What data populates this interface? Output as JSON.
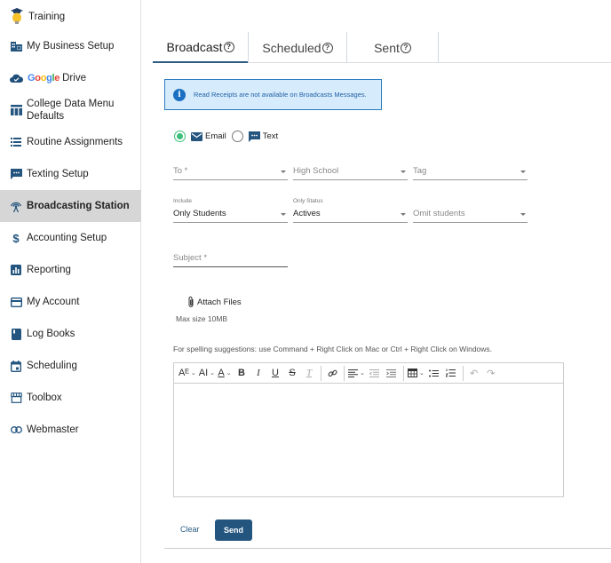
{
  "sidebar": {
    "items": [
      {
        "label": "Training",
        "icon": "lightbulb-graduation-cap-icon"
      },
      {
        "label": "My Business Setup",
        "icon": "building-icon"
      },
      {
        "label_google": "Google",
        "label": "Drive",
        "icon": "cloud-check-icon"
      },
      {
        "label": "College Data Menu Defaults",
        "icon": "table-columns-icon"
      },
      {
        "label": "Routine Assignments",
        "icon": "list-icon"
      },
      {
        "label": "Texting Setup",
        "icon": "chat-bubble-icon"
      },
      {
        "label": "Broadcasting Station",
        "icon": "broadcast-antenna-icon",
        "active": true
      },
      {
        "label": "Accounting Setup",
        "icon": "dollar-icon"
      },
      {
        "label": "Reporting",
        "icon": "bar-chart-icon"
      },
      {
        "label": "My Account",
        "icon": "credit-card-icon"
      },
      {
        "label": "Log Books",
        "icon": "book-icon"
      },
      {
        "label": "Scheduling",
        "icon": "calendar-icon"
      },
      {
        "label": "Toolbox",
        "icon": "storefront-icon"
      },
      {
        "label": "Webmaster",
        "icon": "link-icon"
      }
    ]
  },
  "tabs": [
    {
      "label": "Broadcast",
      "active": true
    },
    {
      "label": "Scheduled",
      "active": false
    },
    {
      "label": "Sent",
      "active": false
    }
  ],
  "info": {
    "message": "Read Receipts are not available on Broadcasts Messages."
  },
  "channel": {
    "selected": "Email",
    "options": [
      "Email",
      "Text"
    ]
  },
  "filters": {
    "to": {
      "placeholder": "To *"
    },
    "high_school": {
      "placeholder": "High School"
    },
    "tag": {
      "placeholder": "Tag"
    },
    "include": {
      "label": "Include",
      "value": "Only Students"
    },
    "only_status": {
      "label": "Only Status",
      "value": "Actives"
    },
    "omit": {
      "placeholder": "Omit students"
    }
  },
  "subject": {
    "placeholder": "Subject *"
  },
  "attach": {
    "label": "Attach Files",
    "max_size": "Max size 10MB"
  },
  "spell_hint": "For spelling suggestions: use Command + Right Click on Mac or Ctrl + Right Click on Windows.",
  "editor": {
    "toolbar": {
      "font_family": "Aᴱ",
      "font_size": "AI",
      "font_color": "A",
      "bold": "B",
      "italic": "I",
      "underline": "U",
      "strikethrough": "S",
      "clear_format": "T",
      "link": "⧉",
      "align": "≡",
      "undo": "↶",
      "redo": "↷"
    },
    "content": ""
  },
  "actions": {
    "clear": "Clear",
    "send": "Send"
  },
  "colors": {
    "primary": "#23557f",
    "info_bg": "#d6ebfb",
    "info_border": "#2c7bc0",
    "radio_checked": "#3bbf7a",
    "sidebar_active": "#d6d6d6"
  }
}
